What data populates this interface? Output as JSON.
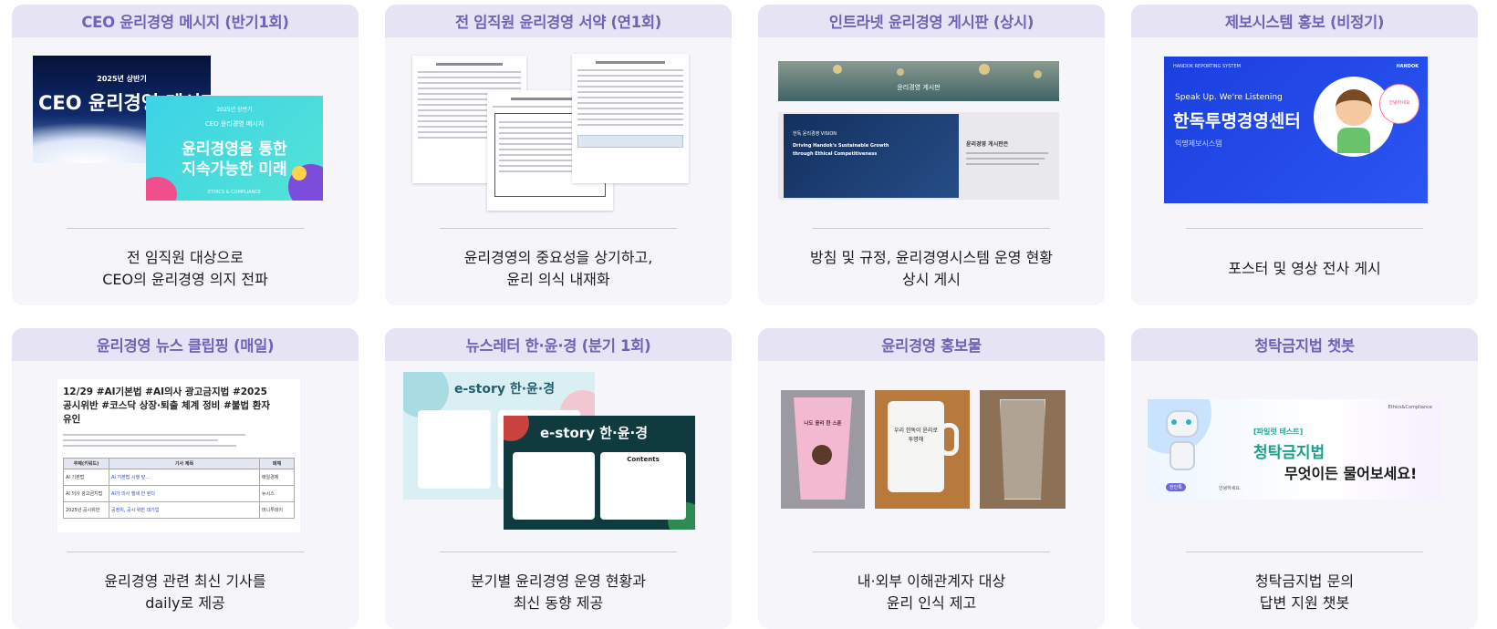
{
  "cards": [
    {
      "title": "CEO 윤리경영 메시지 (반기1회)",
      "desc": [
        "전 임직원 대상으로",
        "CEO의 윤리경영 의지 전파"
      ],
      "thumb": {
        "a_top": "2025년 상반기",
        "a_main": "CEO 윤리경영 메시지",
        "b_top": "2025년 상반기",
        "b_sub": "CEO 윤리경영 메시지",
        "b_main1": "윤리경영을 통한",
        "b_main2": "지속가능한 미래",
        "b_foot": "ETHICS & COMPLIANCE"
      }
    },
    {
      "title": "전 임직원 윤리경영 서약 (연1회)",
      "desc": [
        "윤리경영의 중요성을 상기하고,",
        "윤리 의식 내재화"
      ],
      "thumb": {}
    },
    {
      "title": "인트라넷 윤리경영 게시판 (상시)",
      "desc": [
        "방침 및 규정, 윤리경영시스템 운영 현황",
        "상시 게시"
      ],
      "thumb": {
        "banner": "윤리경영 게시판",
        "vision_title": "한독 윤리경영 VISION",
        "vision_main1": "Driving Handok's Sustainable Growth",
        "vision_main2": "through Ethical Competitiveness",
        "side_title": "윤리경영 게시판은"
      }
    },
    {
      "title": "제보시스템 홍보 (비정기)",
      "desc": [
        "포스터 및 영상 전사 게시"
      ],
      "thumb": {
        "brand": "HANDOK REPORTING SYSTEM",
        "logo": "HANDOK",
        "slogan": "Speak Up. We're Listening",
        "main": "한독투명경영센터",
        "sub": "익명제보시스템",
        "bubble": "안녕하세요"
      }
    },
    {
      "title": "윤리경영 뉴스 클립핑 (매일)",
      "desc": [
        "윤리경영 관련 최신 기사를",
        "daily로 제공"
      ],
      "thumb": {
        "headline1": "12/29 #AI기본법 #AI의사 광고금지법 #2025",
        "headline2": "공시위반 #코스닥 상장·퇴출 체계 정비 #불법 환자",
        "headline3": "유인",
        "table_headers": [
          "주제(키워드)",
          "기사 제목",
          "매체"
        ],
        "rows": [
          [
            "AI 기본법",
            "AI 기본법 시행 앞...",
            "매일경제"
          ],
          [
            "AI 의사 광고금지법",
            "AI가 의사 행세 안 된다",
            "뉴시스"
          ],
          [
            "2025년 공시위반",
            "공정위, 공시 위반 대기업",
            "머니투데이"
          ]
        ]
      }
    },
    {
      "title": "뉴스레터 한·윤·경 (분기 1회)",
      "desc": [
        "분기별 윤리경영 운영 현황과",
        "최신 동향 제공"
      ],
      "thumb": {
        "a_brand": "e-story 한·윤·경",
        "b_brand": "e-story 한·윤·경",
        "b_box": "Contents"
      }
    },
    {
      "title": "윤리경영 홍보물",
      "desc": [
        "내·외부 이해관계자 대상",
        "윤리 인식 제고"
      ],
      "thumb": {
        "cup1_text": "나도 윤리 한 스푼",
        "cup2_text": "우리 한독이 윤리로 투명해"
      }
    },
    {
      "title": "청탁금지법 챗봇",
      "desc": [
        "청탁금지법 문의",
        "답변 지원 챗봇"
      ],
      "thumb": {
        "tag": "[파일럿 테스트]",
        "main1": "청탁금지법",
        "main2": "무엇이든 물어보세요!",
        "corner": "Ethics&Compliance",
        "bot_label": "한인톡",
        "greet": "안녕하세요."
      }
    }
  ]
}
